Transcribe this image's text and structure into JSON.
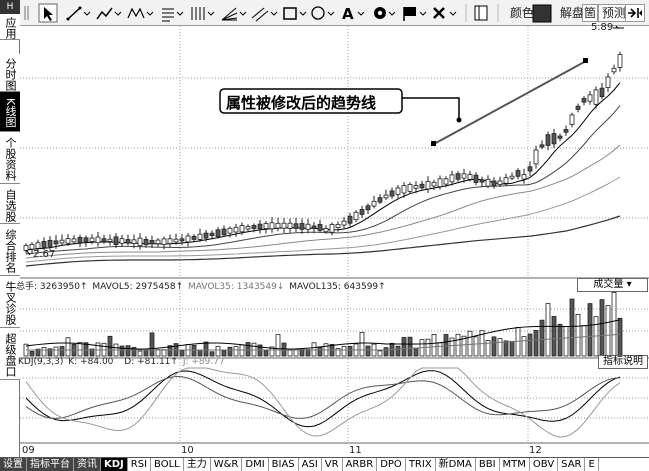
{
  "sidebar": {
    "top": "H",
    "items": [
      {
        "label": "应用",
        "active": false
      },
      {
        "label": "分时图",
        "active": false
      },
      {
        "label": "K线图",
        "active": true
      },
      {
        "label": "个股资料",
        "active": false
      },
      {
        "label": "自选股",
        "active": false
      },
      {
        "label": "综合排名",
        "active": false
      },
      {
        "label": "牛叉诊股",
        "active": false
      },
      {
        "label": "超级盘口",
        "active": false
      }
    ]
  },
  "toolbar": {
    "color_label": "颜色",
    "unlock_label": "解盘",
    "predict_label": "预测",
    "partial_label": "箇"
  },
  "kline": {
    "annotation": "属性被修改后的趋势线",
    "high_price": "5.89",
    "low_price": "2.67"
  },
  "volume": {
    "total_label": "总手: 3263950",
    "mavol5": "MAVOL5: 2975458",
    "mavol35": "MAVOL35: 1343549",
    "mavol135": "MAVOL135: 643599",
    "button": "成交量"
  },
  "kdj": {
    "name": "KDJ(9,3,3)",
    "k": "K: +84.00",
    "d": "D: +81.11",
    "j": "J: +89.77",
    "button": "指标说明"
  },
  "x_axis": {
    "labels": [
      "09",
      "10",
      "11",
      "12"
    ]
  },
  "tabs": [
    "设置",
    "指标平台",
    "资讯",
    "KDJ",
    "RSI",
    "BOLL",
    "主力",
    "W&R",
    "DMI",
    "BIAS",
    "ASI",
    "VR",
    "ARBR",
    "DPO",
    "TRIX",
    "新DMA",
    "BBI",
    "MTM",
    "OBV",
    "SAR",
    "E"
  ],
  "colors": {
    "candle_up_fill": "#ffffff",
    "candle_down_fill": "#555555",
    "trend_line": "#555555",
    "toolbar_bg": "#f2f2f2"
  }
}
